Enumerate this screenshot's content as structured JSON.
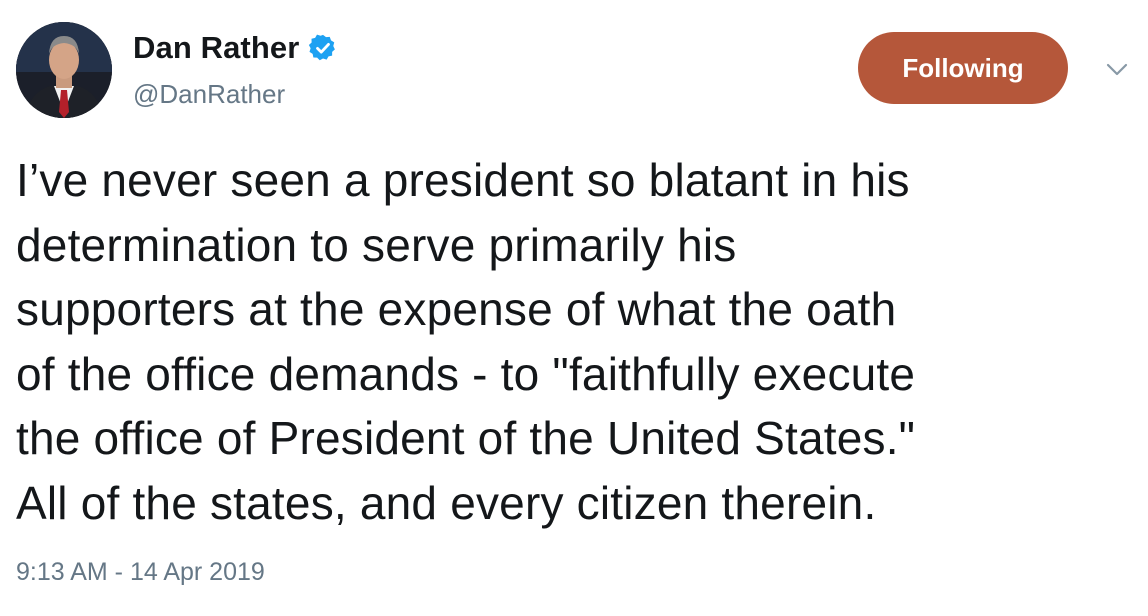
{
  "author": {
    "display_name": "Dan Rather",
    "handle": "@DanRather",
    "verified_icon": "verified-badge-icon",
    "avatar_icon": "profile-photo"
  },
  "follow_button": {
    "label": "Following"
  },
  "menu": {
    "icon": "chevron-down-icon"
  },
  "tweet": {
    "text": "I’ve never seen a president so blatant in his\ndetermination to serve primarily his\nsupporters at the expense of what the oath\nof the office demands - to \"faithfully execute\nthe office of President of the United States.\"\nAll of the states, and every citizen therein.",
    "timestamp": "9:13 AM - 14 Apr 2019"
  },
  "colors": {
    "follow_button_bg": "#b5573a",
    "verified_blue": "#1da1f2",
    "secondary_text": "#657786",
    "primary_text": "#14171a"
  }
}
